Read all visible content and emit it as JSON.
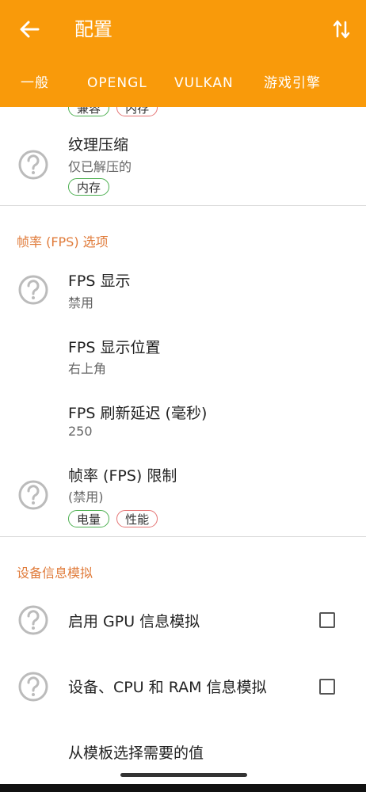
{
  "app_bar": {
    "title": "配置",
    "back_icon": "arrow-left-icon",
    "sort_icon": "swap-vertical-icon"
  },
  "tabs": [
    {
      "label": "一般"
    },
    {
      "label": "OPENGL"
    },
    {
      "label": "VULKAN"
    },
    {
      "label": "游戏引擎"
    }
  ],
  "partial_chips": [
    "兼容",
    "内存"
  ],
  "texture": {
    "title": "纹理压缩",
    "subtitle": "仅已解压的",
    "chip": "内存"
  },
  "fps_section": {
    "header": "帧率 (FPS) 选项",
    "fps_display": {
      "title": "FPS 显示",
      "subtitle": "禁用"
    },
    "fps_position": {
      "title": "FPS 显示位置",
      "subtitle": "右上角"
    },
    "fps_refresh": {
      "title": "FPS 刷新延迟 (毫秒)",
      "subtitle": "250"
    },
    "fps_limit": {
      "title": "帧率 (FPS) 限制",
      "subtitle": "(禁用)",
      "chips": [
        "电量",
        "性能"
      ]
    }
  },
  "spoof_section": {
    "header": "设备信息模拟",
    "gpu_spoof": {
      "title": "启用 GPU 信息模拟",
      "checked": false
    },
    "device_spoof": {
      "title": "设备、CPU 和 RAM 信息模拟",
      "checked": false
    },
    "template": {
      "title": "从模板选择需要的值"
    }
  },
  "colors": {
    "accent": "#F99A0A",
    "section_header": "#E07B3A",
    "chip_green": "#4CAF50",
    "chip_red": "#E57373"
  }
}
